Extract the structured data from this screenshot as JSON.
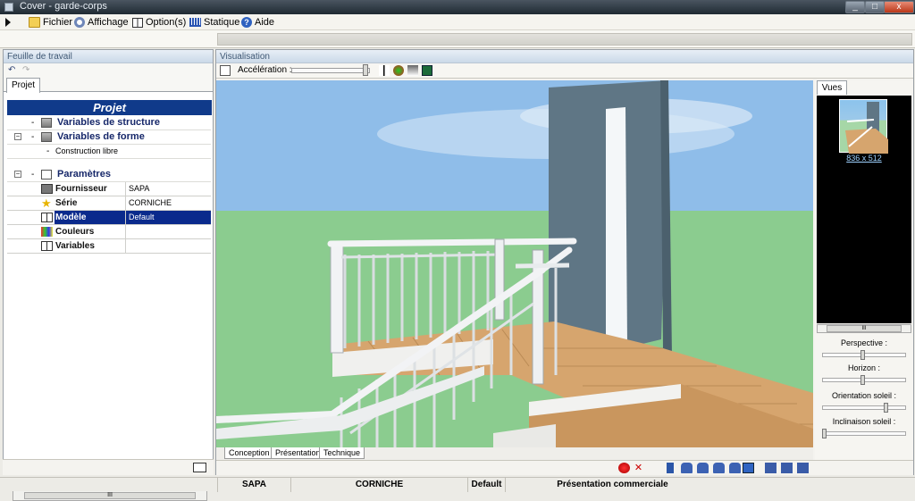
{
  "window": {
    "title": "Cover - garde-corps",
    "minimize": "_",
    "maximize": "□",
    "close": "x"
  },
  "menu": {
    "fichier": "Fichier",
    "affichage": "Affichage",
    "options": "Option(s)",
    "statique": "Statique",
    "aide": "Aide"
  },
  "left_panel": {
    "title": "Feuille de travail",
    "tab": "Projet",
    "header": "Projet",
    "tree": {
      "structure": "Variables de structure",
      "forme": "Variables de forme",
      "construction": "Construction libre",
      "parametres": "Paramètres"
    },
    "properties": [
      {
        "label": "Fournisseur",
        "value": "SAPA"
      },
      {
        "label": "Série",
        "value": "CORNICHE"
      },
      {
        "label": "Modèle",
        "value": "Default"
      },
      {
        "label": "Couleurs",
        "value": ""
      },
      {
        "label": "Variables",
        "value": ""
      }
    ],
    "scroll_grip": "III"
  },
  "vis_panel": {
    "title": "Visualisation",
    "acceleration_label": "Accélération :",
    "acceleration_level": 0.93,
    "tabs": [
      "Conception",
      "Présentation",
      "Technique"
    ],
    "vues_tab": "Vues",
    "thumbnail_caption": "836 x 512",
    "scroll_grip": "III",
    "controls": [
      {
        "label": "Perspective :",
        "level": 0.48
      },
      {
        "label": "Horizon :",
        "level": 0.48
      },
      {
        "label": "Orientation soleil :",
        "level": 0.78
      },
      {
        "label": "Inclinaison soleil :",
        "level": 0.0
      }
    ]
  },
  "status": {
    "fournisseur": "SAPA",
    "serie": "CORNICHE",
    "modele": "Default",
    "presentation": "Présentation commerciale"
  },
  "colors": {
    "selection": "#0a2a8c",
    "header": "#103a8a",
    "sky": "#8fbde9",
    "grass": "#8bcc8f",
    "wall": "#5f7685",
    "floor": "#d6a56e"
  }
}
